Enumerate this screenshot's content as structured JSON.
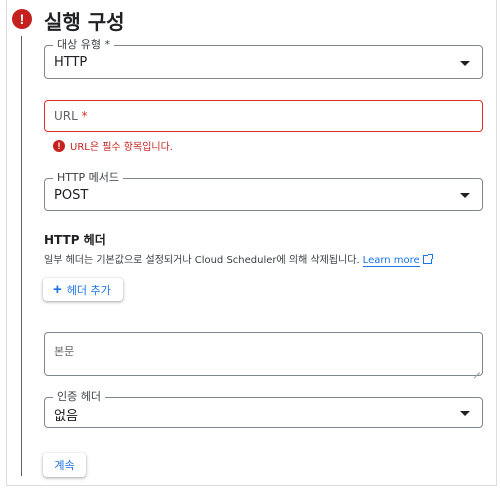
{
  "step": {
    "title": "실행 구성",
    "status_icon": "error-icon",
    "status_color": "#c5221f"
  },
  "target_type": {
    "label": "대상 유형 *",
    "value": "HTTP"
  },
  "url": {
    "placeholder": "URL",
    "required_mark": "*",
    "error_text": "URL은 필수 항목입니다."
  },
  "http_method": {
    "label": "HTTP 메서드",
    "value": "POST"
  },
  "http_headers": {
    "heading": "HTTP 헤더",
    "help_text": "일부 헤더는 기본값으로 설정되거나 Cloud Scheduler에 의해 삭제됩니다.",
    "learn_more": "Learn more",
    "add_button": "헤더 추가"
  },
  "body": {
    "placeholder": "본문"
  },
  "auth_header": {
    "label": "인증 헤더",
    "value": "없음"
  },
  "continue_button": "계속",
  "colors": {
    "accent": "#1a73e8",
    "error": "#d93025"
  }
}
